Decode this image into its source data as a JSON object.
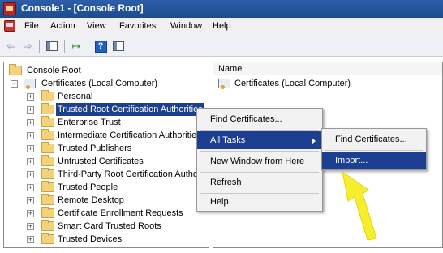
{
  "window": {
    "title": "Console1 - [Console Root]"
  },
  "menu": [
    "File",
    "Action",
    "View",
    "Favorites",
    "Window",
    "Help"
  ],
  "toolbar": {
    "help_label": "?"
  },
  "tree": {
    "root": "Console Root",
    "store": "Certificates (Local Computer)",
    "children": [
      "Personal",
      "Trusted Root Certification Authorities",
      "Enterprise Trust",
      "Intermediate Certification Authorities",
      "Trusted Publishers",
      "Untrusted Certificates",
      "Third-Party Root Certification Authorities",
      "Trusted People",
      "Remote Desktop",
      "Certificate Enrollment Requests",
      "Smart Card Trusted Roots",
      "Trusted Devices"
    ],
    "selected_index": 1
  },
  "right_pane": {
    "column_header": "Name",
    "items": [
      "Certificates (Local Computer)"
    ]
  },
  "context_menu": {
    "items": [
      "Find Certificates...",
      "All Tasks",
      "New Window from Here",
      "Refresh",
      "Help"
    ],
    "highlighted": "All Tasks"
  },
  "submenu": {
    "items": [
      "Find Certificates...",
      "Import..."
    ],
    "highlighted": "Import..."
  },
  "annotation": {
    "arrow_color": "#f7ee2b"
  },
  "colors": {
    "title_bar": "#1d4b90",
    "selection": "#1c3f91"
  }
}
